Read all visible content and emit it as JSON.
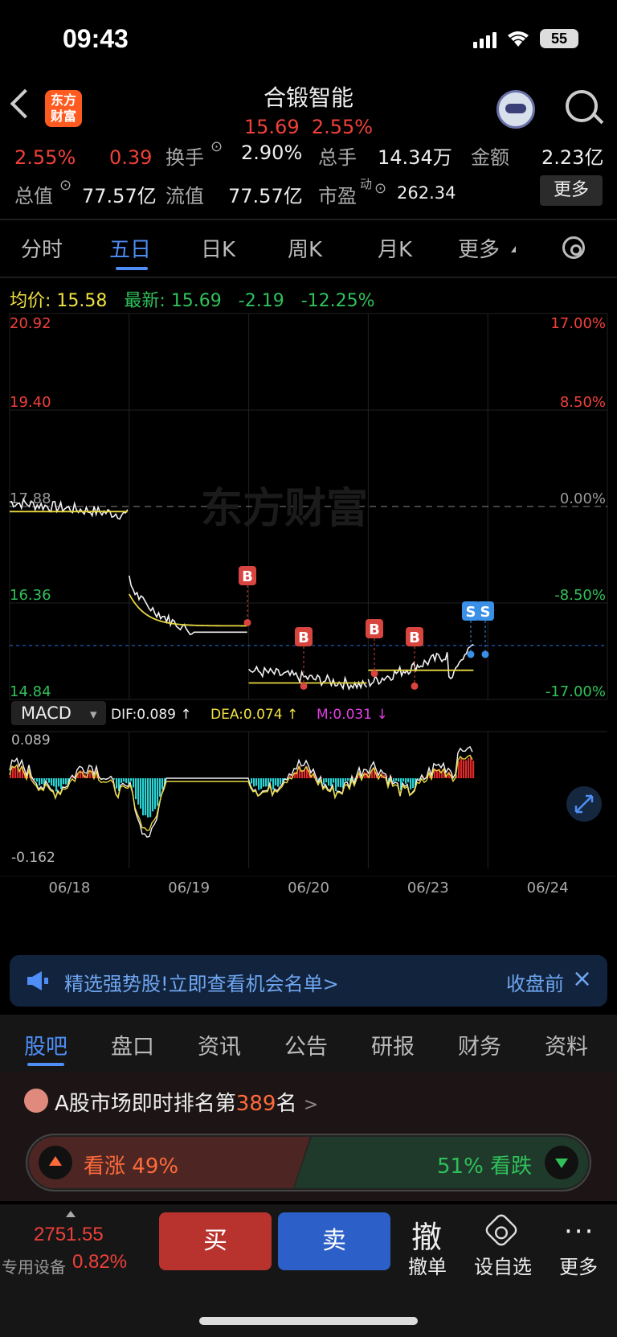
{
  "status": {
    "time": "09:43",
    "battery": "55"
  },
  "header": {
    "logo_line1": "东方",
    "logo_line2": "财富",
    "title": "合锻智能",
    "price": "15.69",
    "change_pct": "2.55%"
  },
  "info": {
    "row1": {
      "pct": "2.55%",
      "chg": "0.39",
      "turnover_label": "换手",
      "turnover": "2.90%",
      "vol_label": "总手",
      "vol": "14.34万",
      "amount_label": "金额",
      "amount": "2.23亿"
    },
    "row2": {
      "mktcap_label": "总值",
      "mktcap": "77.57亿",
      "float_label": "流值",
      "float": "77.57亿",
      "pe_label": "市盈",
      "pe_sup": "动",
      "pe": "262.34",
      "more": "更多"
    }
  },
  "ktabs": [
    "分时",
    "五日",
    "日K",
    "周K",
    "月K",
    "更多"
  ],
  "price_row": {
    "avg_label": "均价:",
    "avg": "15.58",
    "latest_label": "最新:",
    "latest": "15.69",
    "chg": "-2.19",
    "pct": "-12.25%"
  },
  "chart_data": {
    "type": "line",
    "title": "",
    "watermark": "东方财富",
    "y_left_ticks": [
      "20.92",
      "19.40",
      "17.88",
      "16.36",
      "14.84"
    ],
    "y_right_ticks": [
      "17.00%",
      "8.50%",
      "0.00%",
      "-8.50%",
      "-17.00%"
    ],
    "ylim": [
      14.84,
      20.92
    ],
    "prev_close": 17.88,
    "last_price": 15.69,
    "x_ticks": [
      "06/18",
      "06/19",
      "06/20",
      "06/23",
      "06/24"
    ],
    "days": [
      {
        "date": "06/18",
        "price_start": 17.95,
        "price_end": 17.75,
        "avg": 17.8
      },
      {
        "date": "06/19",
        "price_start": 16.8,
        "price_end": 15.9,
        "avg": 16.0
      },
      {
        "date": "06/20",
        "price_start": 15.3,
        "price_end": 15.05,
        "avg": 15.1
      },
      {
        "date": "06/23",
        "price_start": 15.1,
        "price_end": 15.69,
        "avg": 15.3
      }
    ],
    "signals": [
      "B",
      "B",
      "B",
      "B",
      "S",
      "S"
    ],
    "macd": {
      "label": "MACD",
      "dif": "DIF:0.089",
      "dea": "DEA:0.074",
      "m": "M:0.031",
      "top": "0.089",
      "bottom": "-0.162",
      "dif_arrow": "↑",
      "dea_arrow": "↑",
      "m_arrow": "↓"
    }
  },
  "banner": {
    "text": "精选强势股!立即查看机会名单>",
    "right": "收盘前",
    "close": "×"
  },
  "ltabs": [
    "股吧",
    "盘口",
    "资讯",
    "公告",
    "研报",
    "财务",
    "资料"
  ],
  "rank": {
    "prefix": "A股市场即时排名第",
    "number": "389",
    "suffix": "名",
    "chevron": ">"
  },
  "sentiment": {
    "up_label": "看涨",
    "up_pct": "49%",
    "down_pct": "51%",
    "down_label": "看跌"
  },
  "bottom": {
    "index_value": "2751.55",
    "index_label": "专用设备",
    "index_pct": "0.82%",
    "buy": "买",
    "sell": "卖",
    "cancel_icon": "撤",
    "cancel": "撤单",
    "watch": "设自选",
    "more": "更多",
    "more_icon": "···"
  }
}
